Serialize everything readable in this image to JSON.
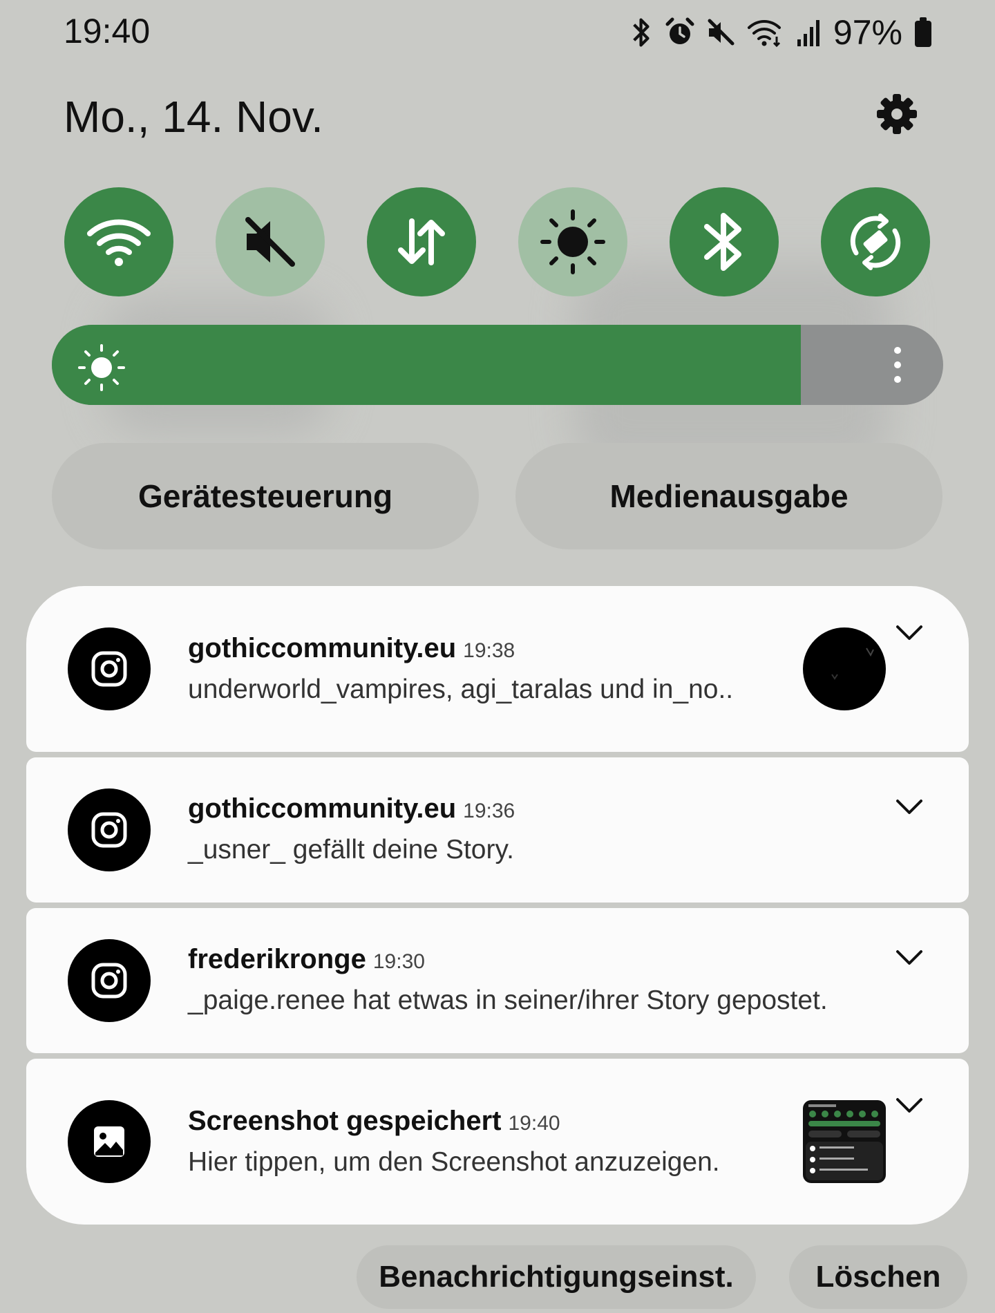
{
  "status_bar": {
    "time": "19:40",
    "battery": "97%",
    "icons": [
      "bluetooth-icon",
      "alarm-icon",
      "mute-icon",
      "wifi-icon",
      "signal-icon",
      "battery-icon"
    ]
  },
  "header": {
    "date": "Mo., 14. Nov."
  },
  "quick_settings": {
    "tiles": [
      {
        "name": "wifi",
        "icon": "wifi-icon",
        "state": "on"
      },
      {
        "name": "sound",
        "icon": "mute-icon",
        "state": "off"
      },
      {
        "name": "mobile-data",
        "icon": "data-transfer-icon",
        "state": "on"
      },
      {
        "name": "dark-mode",
        "icon": "dark-mode-icon",
        "state": "off"
      },
      {
        "name": "bluetooth",
        "icon": "bluetooth-icon",
        "state": "on"
      },
      {
        "name": "auto-rotate",
        "icon": "rotate-icon",
        "state": "on"
      }
    ],
    "brightness_level": 0.84,
    "accent_color": "#3b8748"
  },
  "buttons": {
    "device_control": "Gerätesteuerung",
    "media_output": "Medienausgabe",
    "notification_settings": "Benachrichtigungseinst.",
    "clear": "Löschen"
  },
  "notifications": [
    {
      "title": "gothiccommunity.eu",
      "time": "19:38",
      "body": "underworld_vampires, agi_taralas und in_no..",
      "icon": "instagram-icon"
    },
    {
      "title": "gothiccommunity.eu",
      "time": "19:36",
      "body": "_usner_ gefällt deine Story.",
      "icon": "instagram-icon"
    },
    {
      "title": "frederikronge",
      "time": "19:30",
      "body": "_paige.renee hat etwas in seiner/ihrer Story gepostet.",
      "icon": "instagram-icon"
    },
    {
      "title": "Screenshot gespeichert",
      "time": "19:40",
      "body": "Hier tippen, um den Screenshot anzuzeigen.",
      "icon": "image-icon"
    }
  ]
}
